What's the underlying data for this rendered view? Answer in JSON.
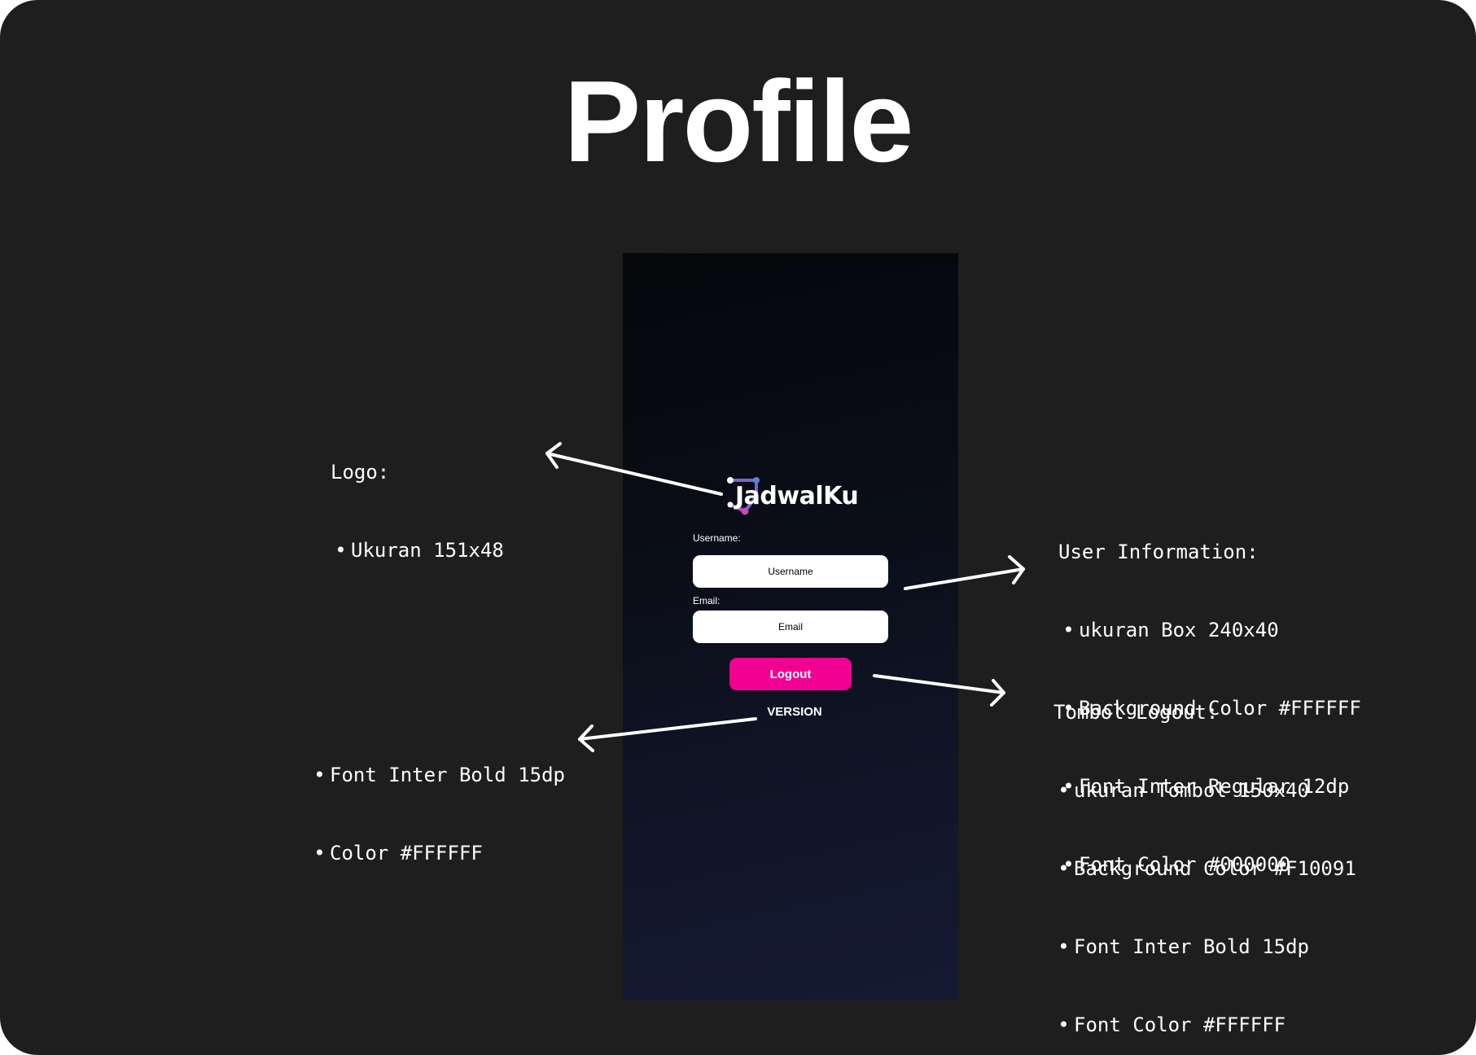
{
  "page_title": "Profile",
  "app": {
    "logo_text": "JadwalKu",
    "username_label": "Username:",
    "username_placeholder": "Username",
    "email_label": "Email:",
    "email_placeholder": "Email",
    "logout_label": "Logout",
    "version_text": "VERSION"
  },
  "annotations": {
    "logo": {
      "heading": "Logo:",
      "items": [
        "Ukuran 151x48"
      ]
    },
    "user_info": {
      "heading": "User Information:",
      "items": [
        "ukuran Box 240x40",
        "Background Color #FFFFFF",
        "Font Inter Regular 12dp",
        "Font Color #000000"
      ]
    },
    "logout": {
      "heading": "Tombol Logout:",
      "items": [
        "ukuran Tombol 150x40",
        "Background Color #F10091",
        "Font Inter Bold 15dp",
        "Font Color #FFFFFF"
      ]
    },
    "version": {
      "items": [
        "Font Inter Bold 15dp",
        "Color #FFFFFF"
      ]
    }
  },
  "colors": {
    "board_background": "#1E1E1E",
    "logout_button": "#F10091",
    "input_background": "#FFFFFF",
    "input_text": "#000000"
  }
}
